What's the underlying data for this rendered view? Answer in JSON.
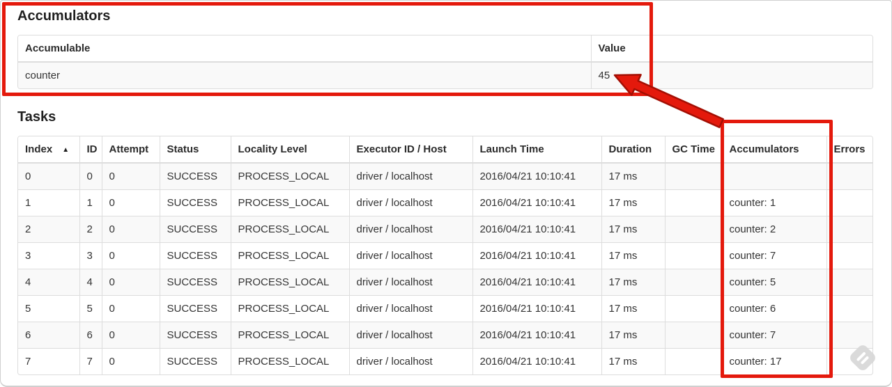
{
  "accumulators_section": {
    "title": "Accumulators",
    "table": {
      "headers": [
        "Accumulable",
        "Value"
      ],
      "rows": [
        {
          "accumulable": "counter",
          "value": "45"
        }
      ]
    }
  },
  "tasks_section": {
    "title": "Tasks",
    "table": {
      "headers": [
        "Index",
        "ID",
        "Attempt",
        "Status",
        "Locality Level",
        "Executor ID / Host",
        "Launch Time",
        "Duration",
        "GC Time",
        "Accumulators",
        "Errors"
      ],
      "rows": [
        {
          "index": "0",
          "id": "0",
          "attempt": "0",
          "status": "SUCCESS",
          "locality_level": "PROCESS_LOCAL",
          "executor_id_host": "driver / localhost",
          "launch_time": "2016/04/21 10:10:41",
          "duration": "17 ms",
          "gc_time": "",
          "accumulators": "",
          "errors": ""
        },
        {
          "index": "1",
          "id": "1",
          "attempt": "0",
          "status": "SUCCESS",
          "locality_level": "PROCESS_LOCAL",
          "executor_id_host": "driver / localhost",
          "launch_time": "2016/04/21 10:10:41",
          "duration": "17 ms",
          "gc_time": "",
          "accumulators": "counter: 1",
          "errors": ""
        },
        {
          "index": "2",
          "id": "2",
          "attempt": "0",
          "status": "SUCCESS",
          "locality_level": "PROCESS_LOCAL",
          "executor_id_host": "driver / localhost",
          "launch_time": "2016/04/21 10:10:41",
          "duration": "17 ms",
          "gc_time": "",
          "accumulators": "counter: 2",
          "errors": ""
        },
        {
          "index": "3",
          "id": "3",
          "attempt": "0",
          "status": "SUCCESS",
          "locality_level": "PROCESS_LOCAL",
          "executor_id_host": "driver / localhost",
          "launch_time": "2016/04/21 10:10:41",
          "duration": "17 ms",
          "gc_time": "",
          "accumulators": "counter: 7",
          "errors": ""
        },
        {
          "index": "4",
          "id": "4",
          "attempt": "0",
          "status": "SUCCESS",
          "locality_level": "PROCESS_LOCAL",
          "executor_id_host": "driver / localhost",
          "launch_time": "2016/04/21 10:10:41",
          "duration": "17 ms",
          "gc_time": "",
          "accumulators": "counter: 5",
          "errors": ""
        },
        {
          "index": "5",
          "id": "5",
          "attempt": "0",
          "status": "SUCCESS",
          "locality_level": "PROCESS_LOCAL",
          "executor_id_host": "driver / localhost",
          "launch_time": "2016/04/21 10:10:41",
          "duration": "17 ms",
          "gc_time": "",
          "accumulators": "counter: 6",
          "errors": ""
        },
        {
          "index": "6",
          "id": "6",
          "attempt": "0",
          "status": "SUCCESS",
          "locality_level": "PROCESS_LOCAL",
          "executor_id_host": "driver / localhost",
          "launch_time": "2016/04/21 10:10:41",
          "duration": "17 ms",
          "gc_time": "",
          "accumulators": "counter: 7",
          "errors": ""
        },
        {
          "index": "7",
          "id": "7",
          "attempt": "0",
          "status": "SUCCESS",
          "locality_level": "PROCESS_LOCAL",
          "executor_id_host": "driver / localhost",
          "launch_time": "2016/04/21 10:10:41",
          "duration": "17 ms",
          "gc_time": "",
          "accumulators": "counter: 17",
          "errors": ""
        }
      ]
    }
  },
  "icons": {
    "sort_ascending": "▲"
  },
  "annotations": {
    "highlight_color": "#e4190c",
    "arrow_outline_color": "#a30f04"
  },
  "colors": {
    "table_border": "#dddddd",
    "row_stripe": "#f9f9f9",
    "text": "#333333"
  }
}
